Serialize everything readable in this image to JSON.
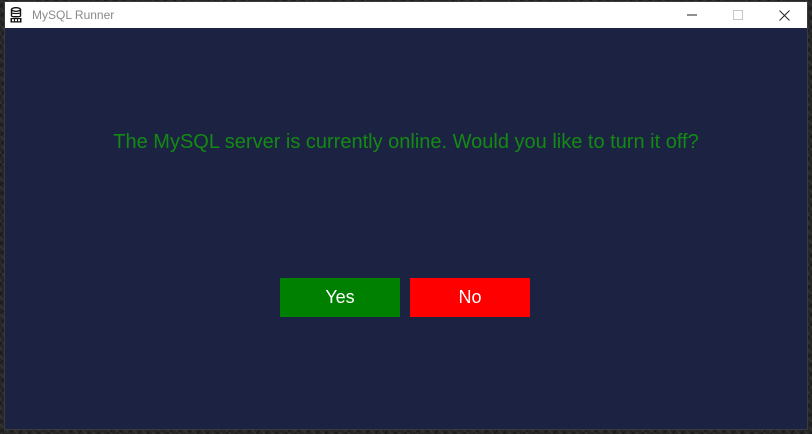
{
  "window": {
    "title": "MySQL Runner",
    "icon": "database-icon"
  },
  "dialog": {
    "message": "The MySQL server is currently online. Would you like to turn it off?",
    "yes_label": "Yes",
    "no_label": "No"
  },
  "colors": {
    "background": "#1c2342",
    "message": "#138a13",
    "yes_button": "#008000",
    "no_button": "#ff0000"
  }
}
